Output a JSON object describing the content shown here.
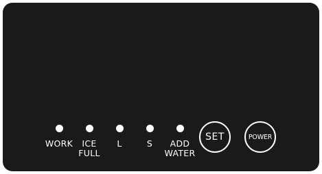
{
  "indicators": [
    {
      "label_line1": "WORK",
      "label_line2": ""
    },
    {
      "label_line1": "ICE",
      "label_line2": "FULL"
    },
    {
      "label_line1": "L",
      "label_line2": ""
    },
    {
      "label_line1": "S",
      "label_line2": ""
    },
    {
      "label_line1": "ADD",
      "label_line2": "WATER"
    }
  ],
  "buttons": {
    "set_label": "SET",
    "power_label": "POWER"
  },
  "colors": {
    "panel": "#1a1a1a",
    "led": "#ffffff",
    "text": "#ffffff"
  }
}
